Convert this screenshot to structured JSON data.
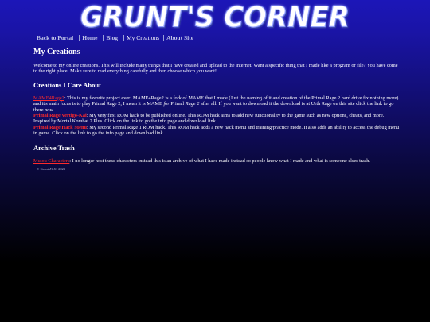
{
  "site": {
    "logo_text": "GRUNT'S CORNER"
  },
  "nav": {
    "back_to_portal": "Back to Portal",
    "home": "Home",
    "blog": "Blog",
    "my_creations": "My Creations",
    "about_site": "About Site"
  },
  "main": {
    "title": "My Creations",
    "intro": "Welcome to my online creations. This will include many things that I have created and upload to the internet. Want a specific thing that I made like a program or file? You have come to the right place! Make sure to read everything carefully and then choose which you want!",
    "section1_heading": "Creations I Care About",
    "creations": [
      {
        "link": "MAME4Rage2",
        "desc_a": ": This is my favorite project ever! MAME4Rage2 is a fork of MAME that I made (Just the naming of it and creation of the Primal Rage 2 hard drive fix nothing more) and it's main focus is to play Primal Rage 2, I mean it is MAME ",
        "desc_italic": "for",
        "desc_b": " Primal ",
        "desc_italic2": "Rage 2",
        "desc_c": " after all. If you want to download it the download is at Urth Rage on this site click the link to go there now."
      },
      {
        "link": "Primal Rage Vertigo-Kai",
        "desc": ": My very first ROM hack to be published online. This ROM hack aims to add new functionality to the game such as new options, cheats, and more. Inspired by Mortal Kombat 2 Plus. Click on the link to go the info page and download link."
      },
      {
        "link": "Primal Rage Hack Menu",
        "desc": ": My second Primal Rage 1 ROM hack. This ROM hack adds a new hack menu and training/practice mode. It also adds an ability to access the debug menu in game. Click on the link to go the info page and download link."
      }
    ],
    "section2_heading": "Archive Trash",
    "archive": [
      {
        "link": "Mutou Characters",
        "desc": ": I no longer host these characters instead this is an archive of what I have made instead so people know what I made and what is someone elses trash."
      }
    ],
    "footer": "© GruntsNeM 2023"
  },
  "colors": {
    "link_red": "#ff2a2a",
    "nav_link": "#c0c4e8",
    "bg_top": "#1c16b8",
    "bg_bottom": "#000000"
  }
}
